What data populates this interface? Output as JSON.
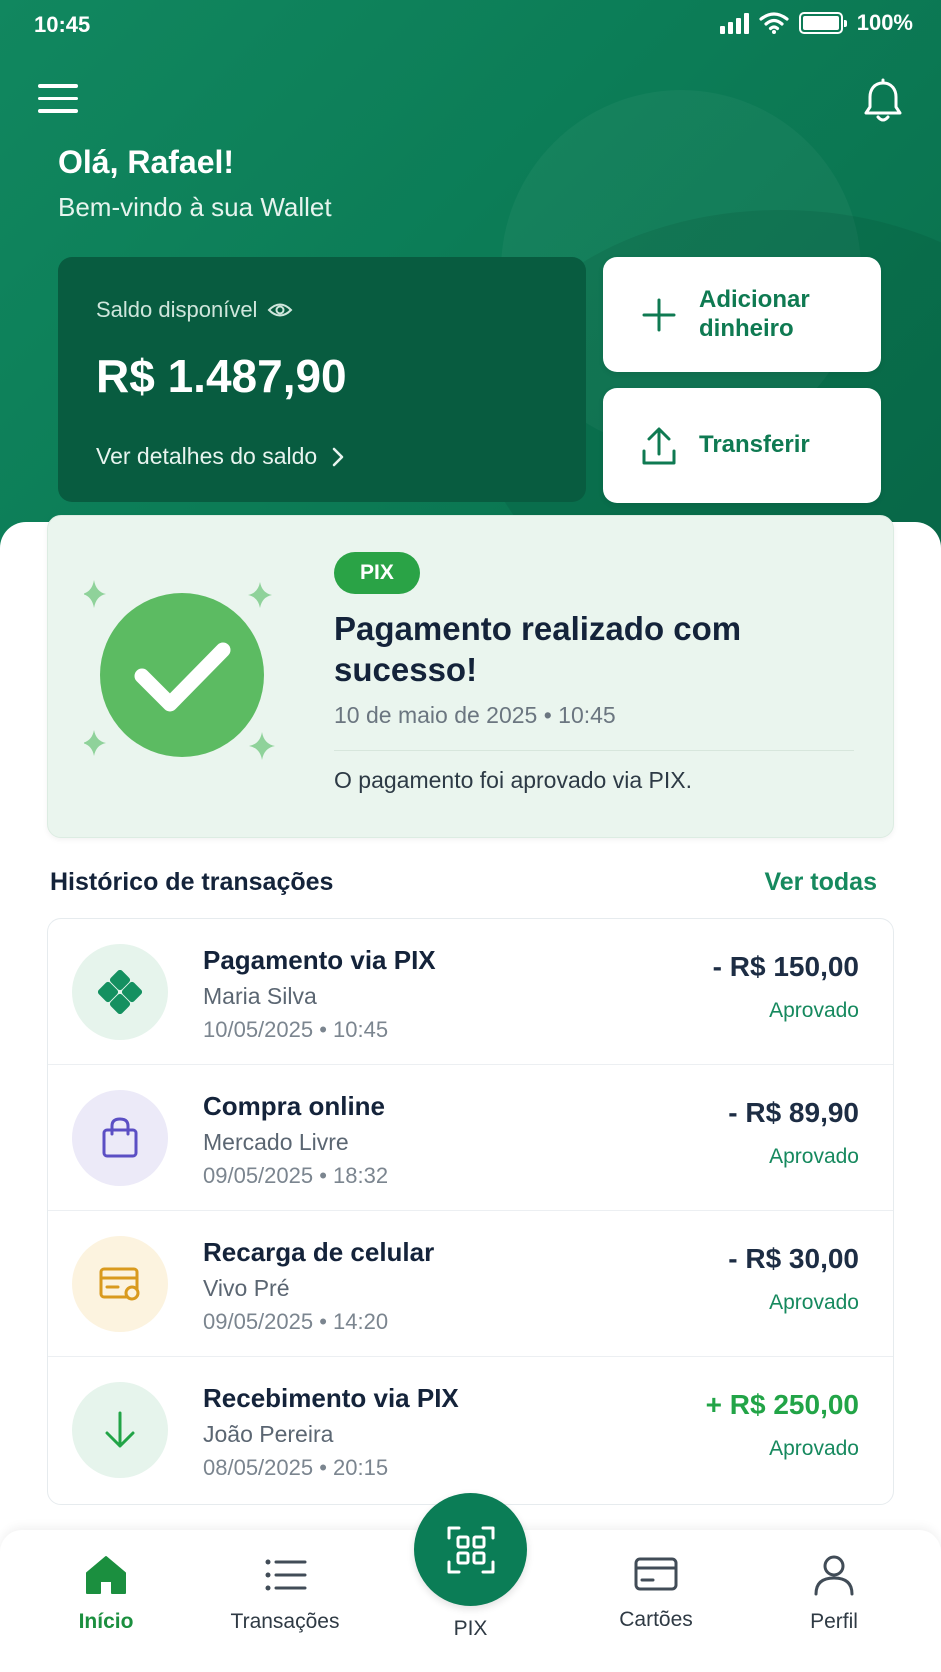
{
  "status_bar": {
    "time": "10:45",
    "battery": "100%"
  },
  "header": {
    "greeting": "Olá, Rafael!",
    "subtitle": "Bem-vindo à sua Wallet",
    "balance": {
      "label": "Saldo disponível",
      "value": "R$ 1.487,90",
      "details_link": "Ver detalhes do saldo"
    },
    "actions": [
      {
        "label": "Adicionar dinheiro",
        "icon": "plus-icon"
      },
      {
        "label": "Transferir",
        "icon": "upload-icon"
      }
    ]
  },
  "success_card": {
    "badge": "PIX",
    "title": "Pagamento realizado com sucesso!",
    "datetime": "10 de maio de 2025 • 10:45",
    "message": "O pagamento foi aprovado via PIX."
  },
  "history": {
    "title": "Histórico de transações",
    "see_all": "Ver todas",
    "transactions": [
      {
        "title": "Pagamento via PIX",
        "subtitle": "Maria Silva",
        "date": "10/05/2025 • 10:45",
        "amount": "- R$ 150,00",
        "status": "Aprovado",
        "icon": "pix-icon"
      },
      {
        "title": "Compra online",
        "subtitle": "Mercado Livre",
        "date": "09/05/2025 • 18:32",
        "amount": "- R$ 89,90",
        "status": "Aprovado",
        "icon": "shopping-bag-icon"
      },
      {
        "title": "Recarga de celular",
        "subtitle": "Vivo Pré",
        "date": "09/05/2025 • 14:20",
        "amount": "- R$ 30,00",
        "status": "Aprovado",
        "icon": "recharge-card-icon"
      },
      {
        "title": "Recebimento via PIX",
        "subtitle": "João Pereira",
        "date": "08/05/2025 • 20:15",
        "amount": "+ R$ 250,00",
        "status": "Aprovado",
        "icon": "arrow-down-icon"
      }
    ]
  },
  "bottom_nav": {
    "items": [
      {
        "label": "Início",
        "icon": "home-icon",
        "active": true
      },
      {
        "label": "Transações",
        "icon": "list-icon"
      },
      {
        "label": "PIX",
        "icon": "qr-code-icon"
      },
      {
        "label": "Cartões",
        "icon": "card-icon"
      },
      {
        "label": "Perfil",
        "icon": "user-icon"
      }
    ]
  },
  "colors": {
    "brand_green": "#0c7d57",
    "balance_card": "#085c40",
    "success_green": "#2aa346",
    "positive_amount": "#22a447",
    "status_approved": "#16895e"
  }
}
